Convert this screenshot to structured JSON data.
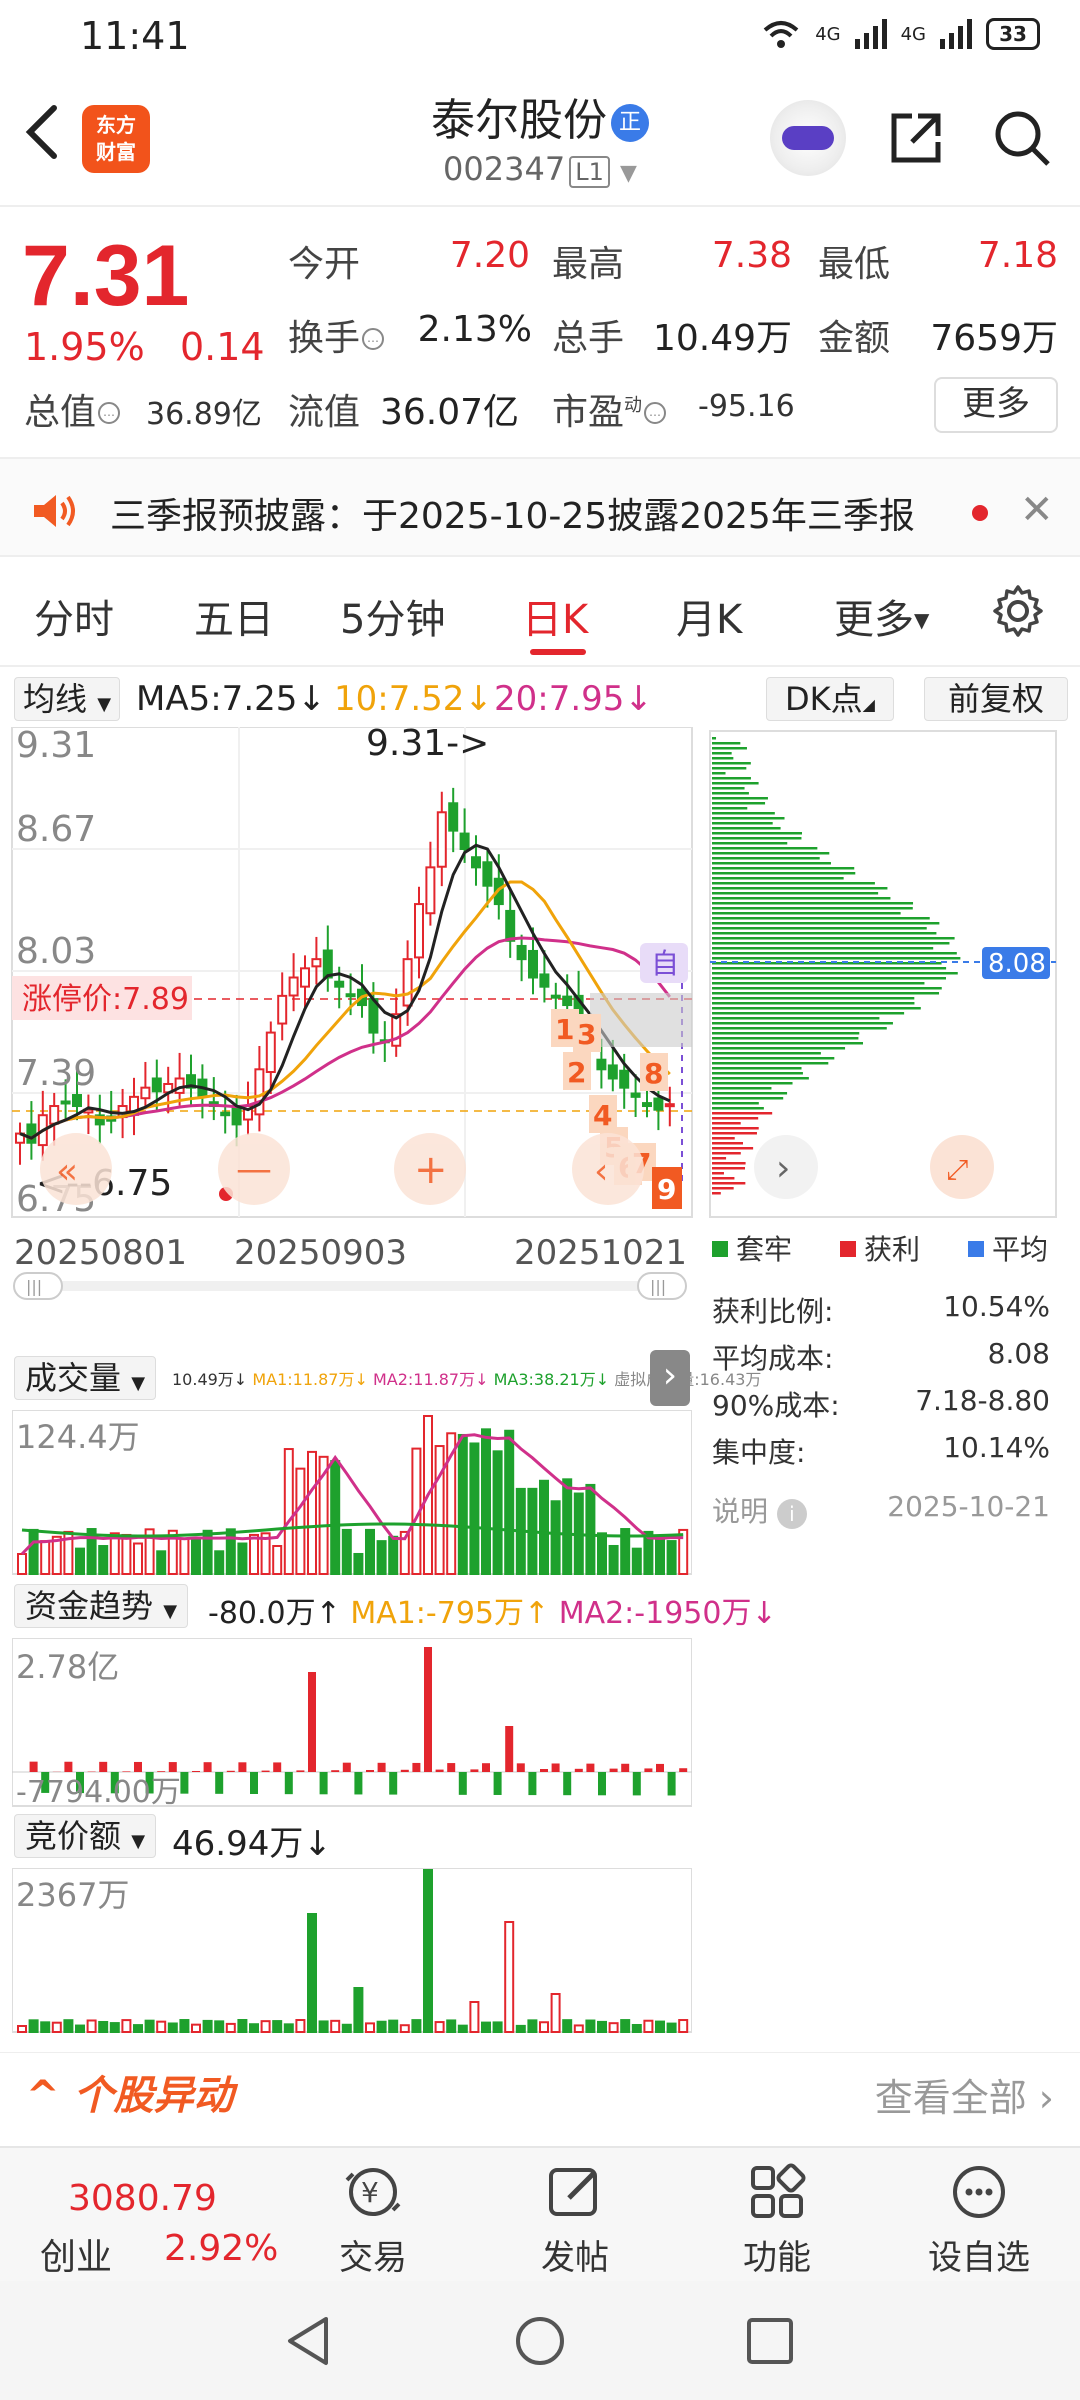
{
  "status": {
    "time": "11:41",
    "net1": "4G",
    "net2": "4G",
    "battery": "33"
  },
  "header": {
    "logo_line1": "东方",
    "logo_line2": "财富",
    "stock_name": "泰尔股份",
    "badge": "正",
    "code": "002347",
    "level": "L1"
  },
  "quote": {
    "price": "7.31",
    "change_pct": "1.95%",
    "change": "0.14",
    "open_label": "今开",
    "open": "7.20",
    "high_label": "最高",
    "high": "7.38",
    "low_label": "最低",
    "low": "7.18",
    "turnover_label": "换手",
    "turnover": "2.13%",
    "volume_label": "总手",
    "volume": "10.49万",
    "amount_label": "金额",
    "amount": "7659万",
    "mktcap_label": "总值",
    "mktcap": "36.89亿",
    "float_label": "流值",
    "float": "36.07亿",
    "pe_label": "市盈",
    "pe_sup": "动",
    "pe": "-95.16",
    "more": "更多"
  },
  "notice": {
    "text": "三季报预披露：于2025-10-25披露2025年三季报"
  },
  "tabs": [
    "分时",
    "五日",
    "5分钟",
    "日K",
    "月K",
    "更多"
  ],
  "active_tab": "日K",
  "ma": {
    "select": "均线",
    "ma5": "MA5:7.25↓",
    "ma10": "10:7.52↓",
    "ma20": "20:7.95↓",
    "ma5_color": "#222222",
    "ma10_color": "#f0a30a",
    "ma20_color": "#d0308a"
  },
  "kchart": {
    "dk_button": "DK点",
    "adj_button": "前复权",
    "y_labels": [
      "9.31",
      "8.67",
      "8.03",
      "7.39",
      "6.75"
    ],
    "high_marker": "9.31->",
    "low_marker": "<--6.75",
    "limit_label": "涨停价:7.89",
    "zi_label": "自",
    "x_labels": [
      "20250801",
      "20250903",
      "20251021"
    ],
    "signals": [
      "1",
      "3",
      "2",
      "4",
      "5",
      "6",
      "7",
      "8",
      "9"
    ],
    "up_color": "#e3262d",
    "down_color": "#1ea12d"
  },
  "chip": {
    "cost_marker": "8.08",
    "legend": [
      "套牢",
      "获利",
      "平均"
    ],
    "legend_colors": [
      "#1ea12d",
      "#e3262d",
      "#3a7be8"
    ],
    "stats": [
      {
        "label": "获利比例:",
        "value": "10.54%"
      },
      {
        "label": "平均成本:",
        "value": "8.08"
      },
      {
        "label": "90%成本:",
        "value": "7.18-8.80"
      },
      {
        "label": "集中度:",
        "value": "10.14%"
      }
    ],
    "note_label": "说明",
    "note_date": "2025-10-21"
  },
  "volume_panel": {
    "title": "成交量",
    "summary": "10.49万↓",
    "ma1": "MA1:11.87万↓",
    "ma2": "MA2:11.87万↓",
    "ma3": "MA3:38.21万↓",
    "virtual": "虚拟成交量:16.43万",
    "max_label": "124.4万"
  },
  "fund_panel": {
    "title": "资金趋势",
    "value": "-80.0万↑",
    "ma1": "MA1:-795万↑",
    "ma2": "MA2:-1950万↓",
    "max_label": "2.78亿",
    "min_label": "-7794.00万"
  },
  "auction_panel": {
    "title": "竞价额",
    "value": "46.94万↓",
    "max_label": "2367万"
  },
  "abnormal": {
    "title": "个股异动",
    "more": "查看全部"
  },
  "bottom": {
    "index_value": "3080.79",
    "index_name": "创业",
    "index_pct": "2.92%",
    "items": [
      "交易",
      "发帖",
      "功能",
      "设自选"
    ]
  }
}
